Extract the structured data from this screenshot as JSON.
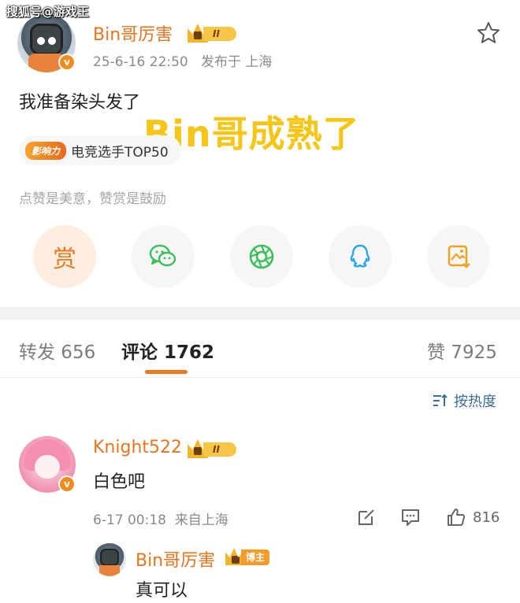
{
  "watermark": "搜狐号@游戏王",
  "post": {
    "author": "Bin哥厉害",
    "level_badge": "II",
    "verified_mark": "v",
    "date": "25-6-16 22:50",
    "location": "发布于 上海",
    "text": "我准备染头发了",
    "overlay_title": "Bin哥成熟了",
    "influence": {
      "badge": "影响力",
      "label": "电竞选手TOP50"
    },
    "tip_hint": "点赞是美意，赞赏是鼓励",
    "reward_label": "赏",
    "share_targets": [
      "wechat-icon",
      "moments-icon",
      "qq-icon",
      "save-image-icon"
    ]
  },
  "tabs": {
    "repost": "转发 656",
    "comments": "评论 1762",
    "likes": "赞 7925"
  },
  "sort_label": "按热度",
  "comment": {
    "user": "Knight522",
    "level_badge": "II",
    "text": "白色吧",
    "time": "6-17 00:18",
    "location": "来自上海",
    "likes": "816"
  },
  "reply": {
    "user": "Bin哥厉害",
    "tag": "博主",
    "text": "真可以"
  },
  "colors": {
    "accent": "#ea7b22",
    "name": "#e8741f",
    "link": "#3e6f94",
    "overlay": "#f5c518",
    "wechat": "#3cbf5a",
    "qq": "#2aa7e6",
    "save": "#f0a020"
  }
}
